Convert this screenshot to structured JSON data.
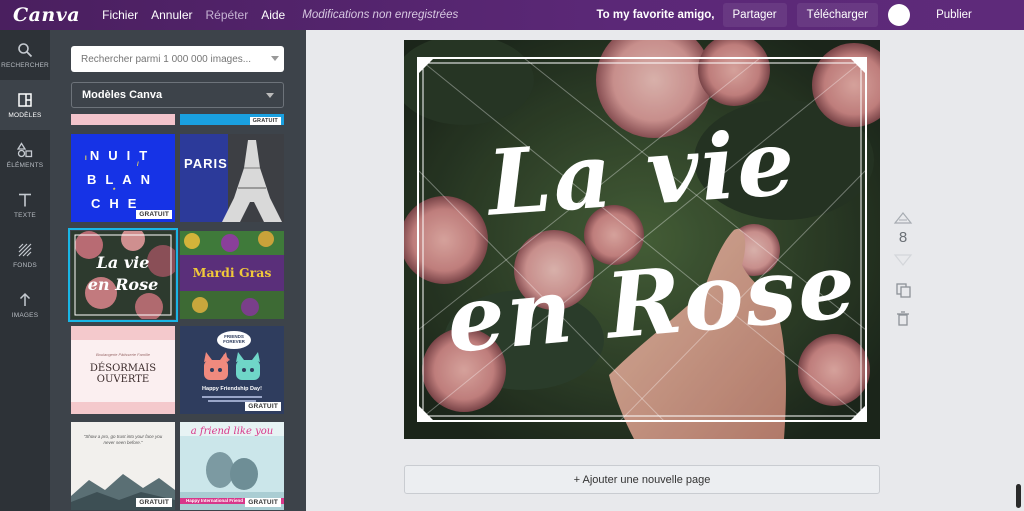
{
  "topbar": {
    "logo": "Canva",
    "menu": [
      {
        "label": "Fichier"
      },
      {
        "label": "Annuler"
      },
      {
        "label": "Répéter"
      },
      {
        "label": "Aide"
      }
    ],
    "unsaved": "Modifications non enregistrées",
    "doc_title": "To my favorite amigo,",
    "share": "Partager",
    "download": "Télécharger",
    "publish": "Publier"
  },
  "rail": [
    {
      "label": "RECHERCHER",
      "icon": "search-icon"
    },
    {
      "label": "MODÈLES",
      "icon": "layout-icon"
    },
    {
      "label": "ÉLÉMENTS",
      "icon": "shapes-icon"
    },
    {
      "label": "TEXTE",
      "icon": "text-icon"
    },
    {
      "label": "FONDS",
      "icon": "pattern-icon"
    },
    {
      "label": "IMAGES",
      "icon": "upload-icon"
    }
  ],
  "panel": {
    "search_placeholder": "Rechercher parmi 1 000 000 images...",
    "select_value": "Modèles Canva",
    "free_badge": "GRATUIT",
    "templates": {
      "nuit": [
        "NUIT",
        "BLAN",
        "CHE"
      ],
      "paris": "PARIS",
      "rose": [
        "La vie",
        "en Rose"
      ],
      "mardi": "Mardi Gras",
      "desormais_small": "Boulangerie Pâtisserie Famille",
      "desormais": "DÉSORMAIS OUVERTE",
      "friends_bubble": "FRIENDS FOREVER",
      "friends_text": "Happy Friendship Day!",
      "quote": "\"Show a pro, go trust into your face you never seen before.\"",
      "friend2": "a friend like you",
      "friend2_footer": "Happy International Friend"
    }
  },
  "design": {
    "line1": "La vie",
    "line2": "en Rose"
  },
  "page_number": "8",
  "add_page": "+ Ajouter une nouvelle page",
  "colors": {
    "topbar": "#5b2877",
    "rail": "#2d3237",
    "panel": "#3d434a",
    "workspace": "#e8e9ec",
    "selection": "#19b6e6"
  }
}
